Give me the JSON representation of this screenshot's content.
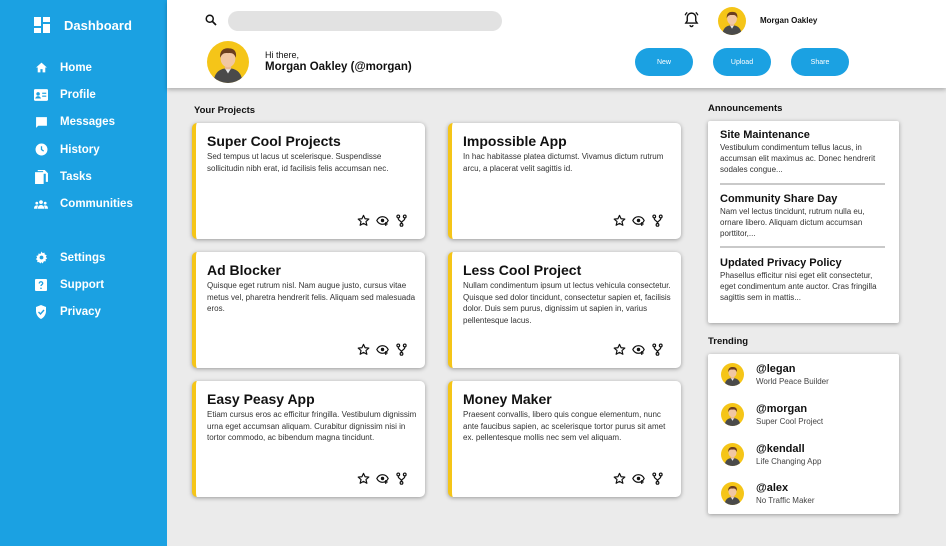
{
  "sidebar": {
    "brand": "Dashboard",
    "items": [
      {
        "label": "Home",
        "icon": "home-icon"
      },
      {
        "label": "Profile",
        "icon": "id-card-icon"
      },
      {
        "label": "Messages",
        "icon": "chat-icon"
      },
      {
        "label": "History",
        "icon": "clock-icon"
      },
      {
        "label": "Tasks",
        "icon": "documents-icon"
      },
      {
        "label": "Communities",
        "icon": "group-icon"
      }
    ],
    "items2": [
      {
        "label": "Settings",
        "icon": "gear-icon"
      },
      {
        "label": "Support",
        "icon": "help-icon"
      },
      {
        "label": "Privacy",
        "icon": "shield-icon"
      }
    ],
    "color": "#1ba1e2"
  },
  "header": {
    "search_placeholder": "",
    "user_name": "Morgan Oakley",
    "greeting": "Hi there,",
    "greeting_name": "Morgan Oakley (@morgan)",
    "buttons": {
      "new": "New",
      "upload": "Upload",
      "share": "Share"
    }
  },
  "projects": {
    "title": "Your Projects",
    "accent": "#f5c518",
    "items": [
      {
        "title": "Super Cool Projects",
        "desc": "Sed tempus ut lacus ut scelerisque. Suspendisse sollicitudin nibh erat, id facilisis felis accumsan nec."
      },
      {
        "title": "Impossible App",
        "desc": "In hac habitasse platea dictumst. Vivamus dictum rutrum arcu, a placerat velit sagittis id."
      },
      {
        "title": "Ad Blocker",
        "desc": "Quisque eget rutrum nisl. Nam augue justo, cursus vitae metus vel, pharetra hendrerit felis. Aliquam sed malesuada eros."
      },
      {
        "title": "Less Cool Project",
        "desc": "Nullam condimentum ipsum ut lectus vehicula consectetur. Quisque sed dolor tincidunt, consectetur sapien et, facilisis dolor. Duis sem purus, dignissim ut sapien in, varius pellentesque lacus."
      },
      {
        "title": "Easy Peasy App",
        "desc": "Etiam cursus eros ac efficitur fringilla. Vestibulum dignissim urna eget accumsan aliquam. Curabitur dignissim nisi in tortor commodo, ac bibendum magna tincidunt."
      },
      {
        "title": "Money Maker",
        "desc": "Praesent convallis, libero quis congue elementum, nunc ante faucibus sapien, ac scelerisque tortor purus sit amet ex. pellentesque mollis nec sem vel aliquam."
      }
    ]
  },
  "announcements": {
    "title": "Announcements",
    "items": [
      {
        "title": "Site Maintenance",
        "text": "Vestibulum condimentum tellus lacus, in accumsan elit maximus ac. Donec hendrerit sodales congue..."
      },
      {
        "title": "Community Share Day",
        "text": "Nam vel lectus tincidunt, rutrum nulla eu, ornare libero. Aliquam dictum accumsan porttitor,..."
      },
      {
        "title": "Updated Privacy Policy",
        "text": "Phasellus efficitur nisi eget elit consectetur, eget condimentum ante auctor. Cras fringilla sagittis sem in mattis..."
      }
    ]
  },
  "trending": {
    "title": "Trending",
    "items": [
      {
        "handle": "@legan",
        "sub": "World Peace Builder"
      },
      {
        "handle": "@morgan",
        "sub": "Super Cool Project"
      },
      {
        "handle": "@kendall",
        "sub": "Life Changing App"
      },
      {
        "handle": "@alex",
        "sub": "No Traffic Maker"
      }
    ]
  }
}
